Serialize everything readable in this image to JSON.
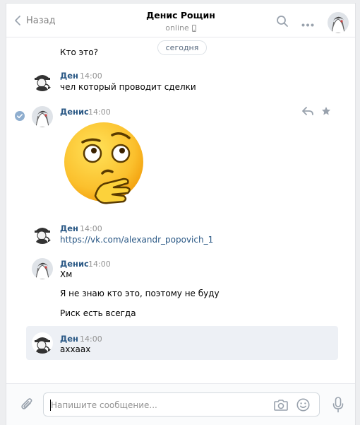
{
  "header": {
    "back_label": "Назад",
    "title": "Денис Рощин",
    "status": "online"
  },
  "date_divider": "сегодня",
  "messages": [
    {
      "author": "",
      "time": "",
      "lines": [
        "Кто это?"
      ]
    },
    {
      "author": "Ден",
      "time": "14:00",
      "lines": [
        "чел который проводит сделки"
      ]
    },
    {
      "author": "Денис",
      "time": "14:00",
      "lines": [],
      "sticker": "thinking-face-sticker"
    },
    {
      "author": "Ден",
      "time": "14:00",
      "lines": [
        "https://vk.com/alexandr_popovich_1"
      ]
    },
    {
      "author": "Денис",
      "time": "14:00",
      "lines": [
        "Хм",
        "Я не знаю кто это, поэтому не буду",
        "Риск есть всегда"
      ]
    },
    {
      "author": "Ден",
      "time": "14:00",
      "lines": [
        "ахxаах"
      ]
    }
  ],
  "composer": {
    "placeholder": "Напишите сообщение..."
  },
  "colors": {
    "link": "#2a5885",
    "meta": "#939393",
    "highlight": "#edf0f5"
  }
}
